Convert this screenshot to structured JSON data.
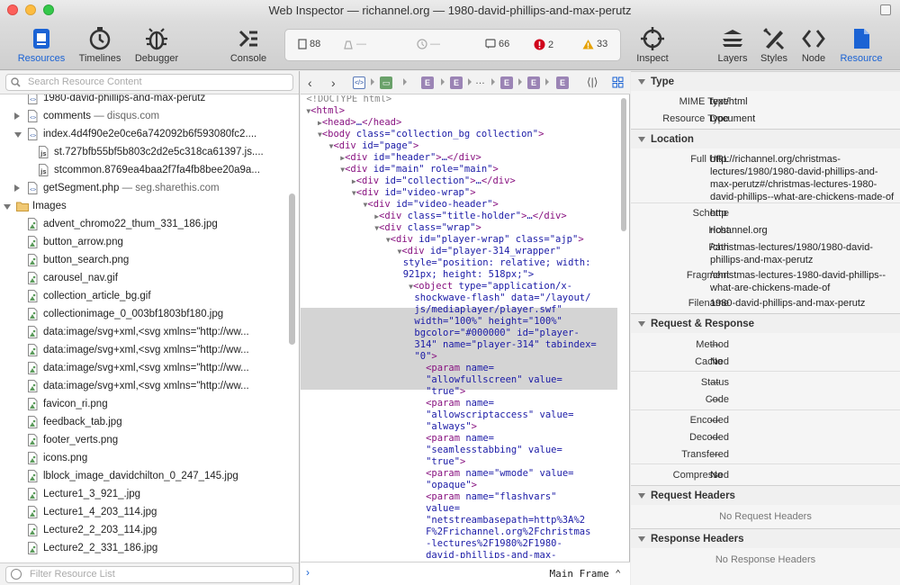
{
  "window": {
    "title": "Web Inspector — richannel.org — 1980-david-phillips-and-max-perutz"
  },
  "toolbar": {
    "resources": "Resources",
    "timelines": "Timelines",
    "debugger": "Debugger",
    "console": "Console",
    "inspect": "Inspect",
    "layers": "Layers",
    "styles": "Styles",
    "node": "Node",
    "resource": "Resource",
    "accent_color": "#1b63d4"
  },
  "dashboard": {
    "resources_count": "88",
    "size": "—",
    "time": "—",
    "logs": "66",
    "errors": "2",
    "warnings": "33",
    "error_color": "#d0021b",
    "warning_color": "#e6a100"
  },
  "sidebar": {
    "search_placeholder": "Search Resource Content",
    "filter_placeholder": "Filter Resource List",
    "rows": [
      {
        "name": "1980-david-phillips-and-max-perutz",
        "domain": "",
        "icon": "document-icon",
        "indent": 1,
        "tri": ""
      },
      {
        "name": "comments",
        "domain": " — disqus.com",
        "icon": "document-icon",
        "indent": 1,
        "tri": "right"
      },
      {
        "name": "index.4d4f90e2e0ce6a742092b6f593080fc2....",
        "domain": "",
        "icon": "document-icon",
        "indent": 1,
        "tri": "down"
      },
      {
        "name": "st.727bfb55bf5b803c2d2e5c318ca61397.js....",
        "domain": "",
        "icon": "script-icon",
        "indent": 2,
        "tri": ""
      },
      {
        "name": "stcommon.8769ea4baa2f7fa4fb8bee20a9a...",
        "domain": "",
        "icon": "script-icon",
        "indent": 2,
        "tri": ""
      },
      {
        "name": "getSegment.php",
        "domain": " — seg.sharethis.com",
        "icon": "document-icon",
        "indent": 1,
        "tri": "right"
      },
      {
        "name": "Images",
        "domain": "",
        "icon": "folder-icon",
        "indent": 0,
        "tri": "down"
      },
      {
        "name": "advent_chromo22_thum_331_186.jpg",
        "domain": "",
        "icon": "image-icon",
        "indent": 1,
        "tri": ""
      },
      {
        "name": "button_arrow.png",
        "domain": "",
        "icon": "image-icon",
        "indent": 1,
        "tri": ""
      },
      {
        "name": "button_search.png",
        "domain": "",
        "icon": "image-icon",
        "indent": 1,
        "tri": ""
      },
      {
        "name": "carousel_nav.gif",
        "domain": "",
        "icon": "image-icon",
        "indent": 1,
        "tri": ""
      },
      {
        "name": "collection_article_bg.gif",
        "domain": "",
        "icon": "image-icon",
        "indent": 1,
        "tri": ""
      },
      {
        "name": "collectionimage_0_003bf1803bf180.jpg",
        "domain": "",
        "icon": "image-icon",
        "indent": 1,
        "tri": ""
      },
      {
        "name": "data:image/svg+xml,<svg xmlns=\"http://ww...",
        "domain": "",
        "icon": "image-icon",
        "indent": 1,
        "tri": ""
      },
      {
        "name": "data:image/svg+xml,<svg xmlns=\"http://ww...",
        "domain": "",
        "icon": "image-icon",
        "indent": 1,
        "tri": ""
      },
      {
        "name": "data:image/svg+xml,<svg xmlns=\"http://ww...",
        "domain": "",
        "icon": "image-icon",
        "indent": 1,
        "tri": ""
      },
      {
        "name": "data:image/svg+xml,<svg xmlns=\"http://ww...",
        "domain": "",
        "icon": "image-icon",
        "indent": 1,
        "tri": ""
      },
      {
        "name": "favicon_ri.png",
        "domain": "",
        "icon": "image-icon",
        "indent": 1,
        "tri": ""
      },
      {
        "name": "feedback_tab.jpg",
        "domain": "",
        "icon": "image-icon",
        "indent": 1,
        "tri": ""
      },
      {
        "name": "footer_verts.png",
        "domain": "",
        "icon": "image-icon",
        "indent": 1,
        "tri": ""
      },
      {
        "name": "icons.png",
        "domain": "",
        "icon": "image-icon",
        "indent": 1,
        "tri": ""
      },
      {
        "name": "lblock_image_davidchilton_0_247_145.jpg",
        "domain": "",
        "icon": "image-icon",
        "indent": 1,
        "tri": ""
      },
      {
        "name": "Lecture1_3_921_.jpg",
        "domain": "",
        "icon": "image-icon",
        "indent": 1,
        "tri": ""
      },
      {
        "name": "Lecture1_4_203_114.jpg",
        "domain": "",
        "icon": "image-icon",
        "indent": 1,
        "tri": ""
      },
      {
        "name": "Lecture2_2_203_114.jpg",
        "domain": "",
        "icon": "image-icon",
        "indent": 1,
        "tri": ""
      },
      {
        "name": "Lecture2_2_331_186.jpg",
        "domain": "",
        "icon": "image-icon",
        "indent": 1,
        "tri": ""
      }
    ]
  },
  "dom": {
    "ellipsis": "…",
    "lines": [
      "<!DOCTYPE html>",
      "▼<html>",
      "  ▶<head>…</head>",
      "  ▼<body class=\"collection_bg collection\">",
      "    ▼<div id=\"page\">",
      "      ▶<div id=\"header\">…</div>",
      "      ▼<div id=\"main\" role=\"main\">",
      "        ▶<div id=\"collection\">…</div>",
      "        ▼<div id=\"video-wrap\">",
      "          ▼<div id=\"video-header\">",
      "            ▶<div class=\"title-holder\">…</div>",
      "            ▼<div class=\"wrap\">",
      "              ▼<div id=\"player-wrap\" class=\"ajp\">",
      "                ▼<div id=\"player-314_wrapper\"",
      "                 style=\"position: relative; width:",
      "                 921px; height: 518px;\">",
      "                  ▼<object type=\"application/x-",
      "                   shockwave-flash\" data=\"/layout/",
      "                   js/mediaplayer/player.swf\"",
      "                   width=\"100%\" height=\"100%\"",
      "                   bgcolor=\"#000000\" id=\"player-",
      "                   314\" name=\"player-314\" tabindex=",
      "                   \"0\">",
      "                     <param name=",
      "                     \"allowfullscreen\" value=",
      "                     \"true\">",
      "                     <param name=",
      "                     \"allowscriptaccess\" value=",
      "                     \"always\">",
      "                     <param name=",
      "                     \"seamlesstabbing\" value=",
      "                     \"true\">",
      "                     <param name=\"wmode\" value=",
      "                     \"opaque\">",
      "                     <param name=\"flashvars\"",
      "                     value=",
      "                     \"netstreambasepath=http%3A%2",
      "                     F%2Frichannel.org%2Fchristmas",
      "                     -lectures%2F1980%2F1980-",
      "                     david-phillips-and-max-"
    ],
    "frame_label": "Main Frame"
  },
  "details": {
    "type_title": "Type",
    "mime_label": "MIME Type",
    "mime_value": "text/html",
    "rtype_label": "Resource Type",
    "rtype_value": "Document",
    "location_title": "Location",
    "url_label": "Full URL",
    "url_value": "http://richannel.org/christmas-lectures/1980/1980-david-phillips-and-max-perutz#/christmas-lectures-1980-david-phillips--what-are-chickens-made-of",
    "scheme_label": "Scheme",
    "scheme_value": "http",
    "host_label": "Host",
    "host_value": "richannel.org",
    "path_label": "Path",
    "path_value": "/christmas-lectures/1980/1980-david-phillips-and-max-perutz",
    "fragment_label": "Fragment",
    "fragment_value": "/christmas-lectures-1980-david-phillips--what-are-chickens-made-of",
    "filename_label": "Filename",
    "filename_value": "1980-david-phillips-and-max-perutz",
    "rr_title": "Request & Response",
    "method_label": "Method",
    "method_value": "—",
    "cached_label": "Cached",
    "cached_value": "No",
    "status_label": "Status",
    "status_value": "—",
    "code_label": "Code",
    "code_value": "—",
    "encoded_label": "Encoded",
    "encoded_value": "—",
    "decoded_label": "Decoded",
    "decoded_value": "—",
    "transfered_label": "Transfered",
    "transfered_value": "—",
    "compressed_label": "Compressed",
    "compressed_value": "No",
    "reqh_title": "Request Headers",
    "reqh_empty": "No Request Headers",
    "resh_title": "Response Headers",
    "resh_empty": "No Response Headers"
  }
}
